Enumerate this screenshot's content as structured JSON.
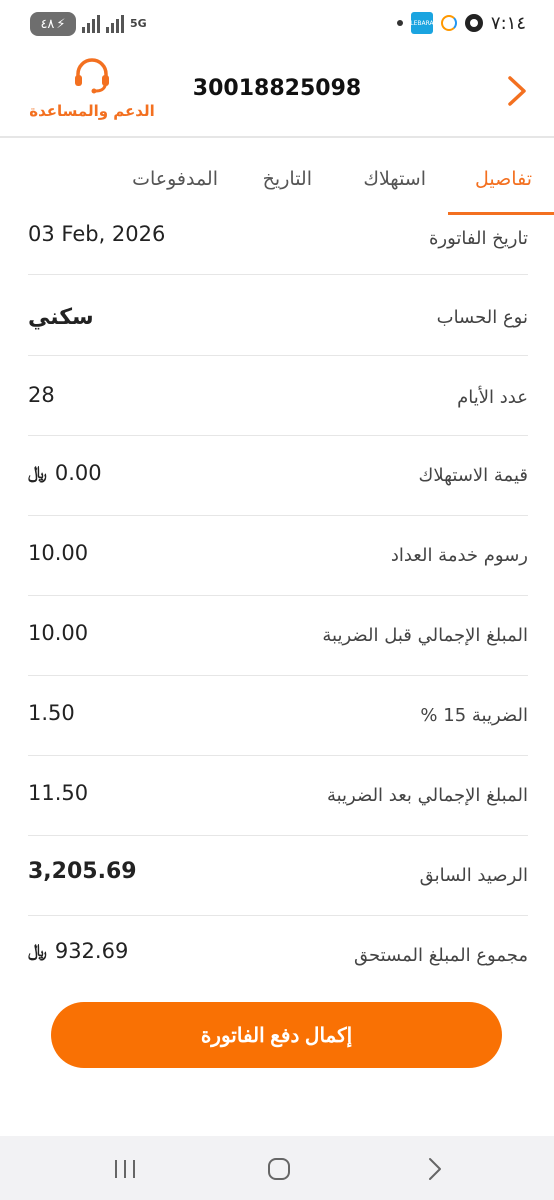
{
  "status_bar": {
    "time": "٧:١٤",
    "battery": "٤٨",
    "network": "5G",
    "lebara_label": "LEBARA"
  },
  "header": {
    "account_number": "30018825098",
    "support_label": "الدعم والمساعدة",
    "back_icon": "chevron-right-icon",
    "support_icon": "headset-icon"
  },
  "tabs": [
    {
      "label": "تفاصيل",
      "active": true
    },
    {
      "label": "استهلاك",
      "active": false
    },
    {
      "label": "التاريخ",
      "active": false
    },
    {
      "label": "المدفوعات",
      "active": false
    }
  ],
  "details": [
    {
      "label": "تاريخ الفاتورة",
      "value": "03 Feb, 2026"
    },
    {
      "label": "نوع الحساب",
      "value": "سكني"
    },
    {
      "label": "عدد الأيام",
      "value": "28"
    },
    {
      "label": "قيمة الاستهلاك",
      "value": "0.00",
      "currency": "﷼"
    },
    {
      "label": "رسوم خدمة العداد",
      "value": "10.00"
    },
    {
      "label": "المبلغ الإجمالي قبل الضريبة",
      "value": "10.00"
    },
    {
      "label": "الضريبة 15 %",
      "value": "1.50"
    },
    {
      "label": "المبلغ الإجمالي بعد الضريبة",
      "value": "11.50"
    },
    {
      "label": "الرصيد السابق",
      "value": "3,205.69"
    },
    {
      "label": "مجموع المبلغ المستحق",
      "value": "932.69",
      "currency": "﷼"
    }
  ],
  "pay_button": {
    "label": "إكمال دفع الفاتورة"
  },
  "colors": {
    "accent": "#f37020",
    "button": "#f97104"
  }
}
